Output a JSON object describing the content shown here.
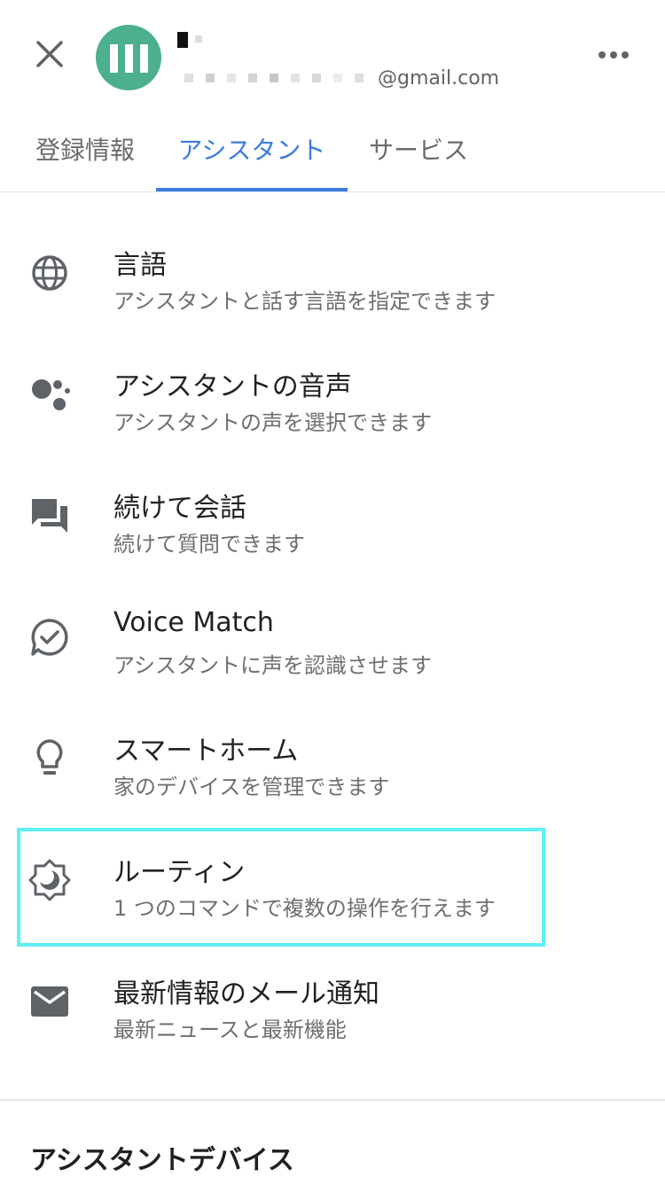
{
  "header": {
    "email": "@gmail.com",
    "close_icon": "close-icon",
    "more_icon": "more-horizontal-icon"
  },
  "tabs": [
    {
      "label": "登録情報",
      "active": false
    },
    {
      "label": "アシスタント",
      "active": true
    },
    {
      "label": "サービス",
      "active": false
    }
  ],
  "colors": {
    "accent": "#3b7be0",
    "avatar": "#4caf8e",
    "highlight": "#5ef1f4",
    "icon": "#5f6368"
  },
  "items": [
    {
      "title": "言語",
      "subtitle": "アシスタントと話す言語を指定できます",
      "icon": "globe-icon"
    },
    {
      "title": "アシスタントの音声",
      "subtitle": "アシスタントの声を選択できます",
      "icon": "assistant-dots-icon"
    },
    {
      "title": "続けて会話",
      "subtitle": "続けて質問できます",
      "icon": "conversation-icon"
    },
    {
      "title": "Voice Match",
      "subtitle": "アシスタントに声を認識させます",
      "icon": "voice-match-check-icon"
    },
    {
      "title": "スマートホーム",
      "subtitle": "家のデバイスを管理できます",
      "icon": "lightbulb-icon"
    },
    {
      "title": "ルーティン",
      "subtitle": "1 つのコマンドで複数の操作を行えます",
      "icon": "routine-sun-moon-icon",
      "highlighted": true
    },
    {
      "title": "最新情報のメール通知",
      "subtitle": "最新ニュースと最新機能",
      "icon": "mail-icon"
    }
  ],
  "section": {
    "header": "アシスタントデバイス"
  }
}
